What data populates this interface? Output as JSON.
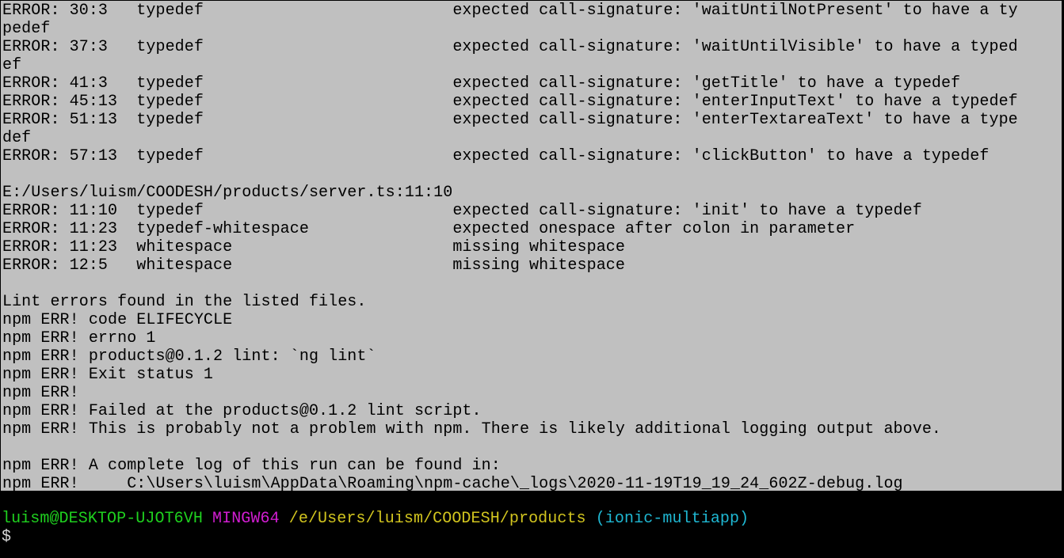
{
  "colors": {
    "output_background": "#c0c0c0",
    "terminal_background": "#000000",
    "user_host": "#1fd11f",
    "system": "#d21dd2",
    "cwd": "#d2c51f",
    "branch": "#1fb7d2"
  },
  "output_lines": [
    "ERROR: 30:3   typedef                          expected call-signature: 'waitUntilNotPresent' to have a ty",
    "pedef",
    "ERROR: 37:3   typedef                          expected call-signature: 'waitUntilVisible' to have a typed",
    "ef",
    "ERROR: 41:3   typedef                          expected call-signature: 'getTitle' to have a typedef",
    "ERROR: 45:13  typedef                          expected call-signature: 'enterInputText' to have a typedef",
    "ERROR: 51:13  typedef                          expected call-signature: 'enterTextareaText' to have a type",
    "def",
    "ERROR: 57:13  typedef                          expected call-signature: 'clickButton' to have a typedef",
    "",
    "E:/Users/luism/COODESH/products/server.ts:11:10",
    "ERROR: 11:10  typedef                          expected call-signature: 'init' to have a typedef",
    "ERROR: 11:23  typedef-whitespace               expected onespace after colon in parameter",
    "ERROR: 11:23  whitespace                       missing whitespace",
    "ERROR: 12:5   whitespace                       missing whitespace",
    "",
    "Lint errors found in the listed files.",
    "npm ERR! code ELIFECYCLE",
    "npm ERR! errno 1",
    "npm ERR! products@0.1.2 lint: `ng lint`",
    "npm ERR! Exit status 1",
    "npm ERR!",
    "npm ERR! Failed at the products@0.1.2 lint script.",
    "npm ERR! This is probably not a problem with npm. There is likely additional logging output above.",
    "",
    "npm ERR! A complete log of this run can be found in:",
    "npm ERR!     C:\\Users\\luism\\AppData\\Roaming\\npm-cache\\_logs\\2020-11-19T19_19_24_602Z-debug.log"
  ],
  "prompt": {
    "user_host": "luism@DESKTOP-UJOT6VH",
    "system": "MINGW64",
    "cwd": "/e/Users/luism/COODESH/products",
    "branch": "(ionic-multiapp)",
    "symbol": "$"
  }
}
